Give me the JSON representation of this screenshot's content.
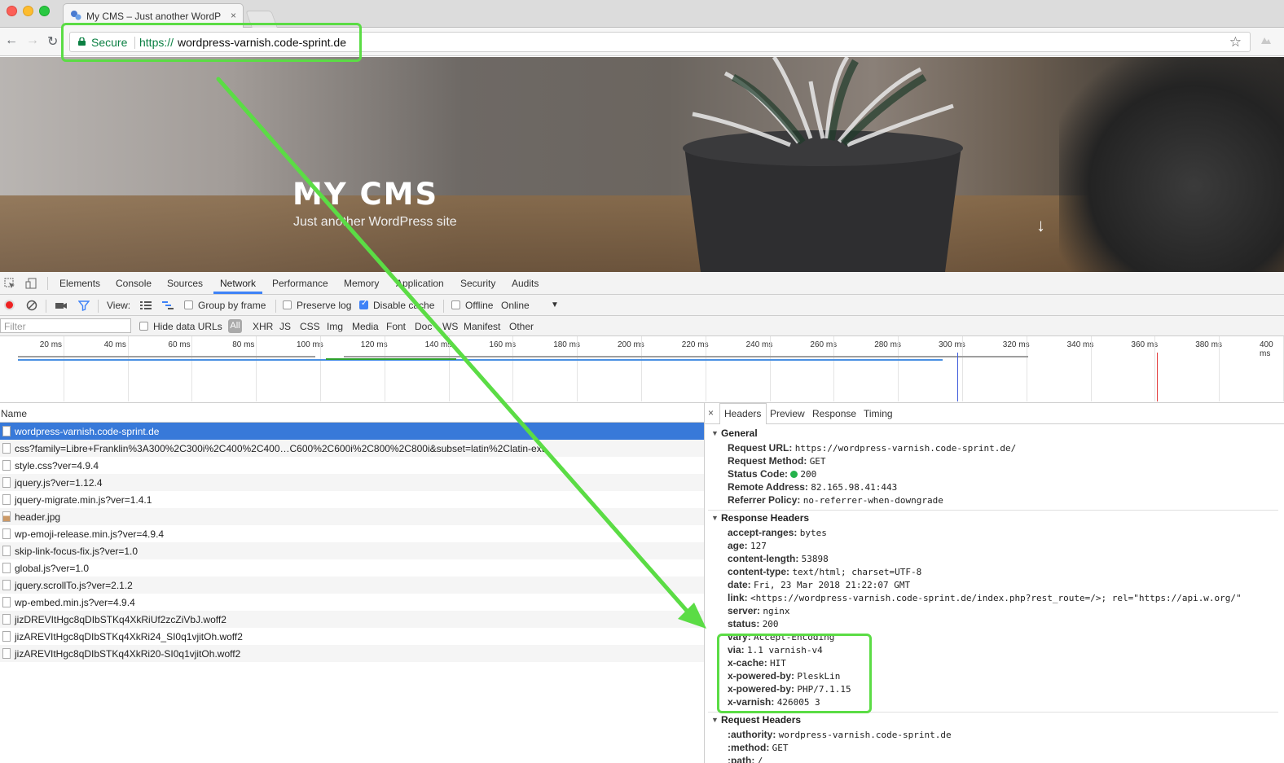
{
  "browser": {
    "tab_title": "My CMS – Just another WordP",
    "tab_close": "×",
    "secure_label": "Secure",
    "url_scheme": "https://",
    "url_host": "wordpress-varnish.code-sprint.de"
  },
  "hero": {
    "site_title": "MY CMS",
    "tagline": "Just another WordPress site",
    "scroll_arrow": "↓"
  },
  "devtools": {
    "tabs": [
      "Elements",
      "Console",
      "Sources",
      "Network",
      "Performance",
      "Memory",
      "Application",
      "Security",
      "Audits"
    ],
    "active_tab": "Network",
    "toolbar": {
      "view_label": "View:",
      "group_by_frame": "Group by frame",
      "preserve_log": "Preserve log",
      "disable_cache": "Disable cache",
      "offline": "Offline",
      "throttle": "Online",
      "throttle_caret": "▼"
    },
    "filter": {
      "placeholder": "Filter",
      "hide_data_urls": "Hide data URLs",
      "types": [
        "All",
        "XHR",
        "JS",
        "CSS",
        "Img",
        "Media",
        "Font",
        "Doc",
        "WS",
        "Manifest",
        "Other"
      ]
    },
    "timeline_ticks": [
      "20 ms",
      "40 ms",
      "60 ms",
      "80 ms",
      "100 ms",
      "120 ms",
      "140 ms",
      "160 ms",
      "180 ms",
      "200 ms",
      "220 ms",
      "240 ms",
      "260 ms",
      "280 ms",
      "300 ms",
      "320 ms",
      "340 ms",
      "360 ms",
      "380 ms",
      "400 ms"
    ],
    "requests_header": "Name",
    "requests": [
      "wordpress-varnish.code-sprint.de",
      "css?family=Libre+Franklin%3A300%2C300i%2C400%2C400…C600%2C600i%2C800%2C800i&subset=latin%2Clatin-ext",
      "style.css?ver=4.9.4",
      "jquery.js?ver=1.12.4",
      "jquery-migrate.min.js?ver=1.4.1",
      "header.jpg",
      "wp-emoji-release.min.js?ver=4.9.4",
      "skip-link-focus-fix.js?ver=1.0",
      "global.js?ver=1.0",
      "jquery.scrollTo.js?ver=2.1.2",
      "wp-embed.min.js?ver=4.9.4",
      "jizDREVItHgc8qDIbSTKq4XkRiUf2zcZiVbJ.woff2",
      "jizAREVItHgc8qDIbSTKq4XkRi24_SI0q1vjitOh.woff2",
      "jizAREVItHgc8qDIbSTKq4XkRi20-SI0q1vjitOh.woff2"
    ],
    "details_tabs": [
      "Headers",
      "Preview",
      "Response",
      "Timing"
    ],
    "details_close": "×",
    "general": {
      "title": "General",
      "rows": [
        {
          "k": "Request URL:",
          "v": "https://wordpress-varnish.code-sprint.de/"
        },
        {
          "k": "Request Method:",
          "v": "GET"
        },
        {
          "k": "Status Code:",
          "v": "200"
        },
        {
          "k": "Remote Address:",
          "v": "82.165.98.41:443"
        },
        {
          "k": "Referrer Policy:",
          "v": "no-referrer-when-downgrade"
        }
      ]
    },
    "response_headers": {
      "title": "Response Headers",
      "rows": [
        {
          "k": "accept-ranges:",
          "v": "bytes"
        },
        {
          "k": "age:",
          "v": "127"
        },
        {
          "k": "content-length:",
          "v": "53898"
        },
        {
          "k": "content-type:",
          "v": "text/html; charset=UTF-8"
        },
        {
          "k": "date:",
          "v": "Fri, 23 Mar 2018 21:22:07 GMT"
        },
        {
          "k": "link:",
          "v": "<https://wordpress-varnish.code-sprint.de/index.php?rest_route=/>; rel=\"https://api.w.org/\""
        },
        {
          "k": "server:",
          "v": "nginx"
        },
        {
          "k": "status:",
          "v": "200"
        },
        {
          "k": "vary:",
          "v": "Accept-Encoding"
        },
        {
          "k": "via:",
          "v": "1.1 varnish-v4"
        },
        {
          "k": "x-cache:",
          "v": "HIT"
        },
        {
          "k": "x-powered-by:",
          "v": "PleskLin"
        },
        {
          "k": "x-powered-by:",
          "v": "PHP/7.1.15"
        },
        {
          "k": "x-varnish:",
          "v": "426005 3"
        }
      ]
    },
    "request_headers": {
      "title": "Request Headers",
      "rows": [
        {
          "k": ":authority:",
          "v": "wordpress-varnish.code-sprint.de"
        },
        {
          "k": ":method:",
          "v": "GET"
        },
        {
          "k": ":path:",
          "v": "/"
        }
      ]
    }
  },
  "colors": {
    "highlight": "#5bdc45",
    "accent": "#3e82f7",
    "selected_row": "#3879d9"
  }
}
